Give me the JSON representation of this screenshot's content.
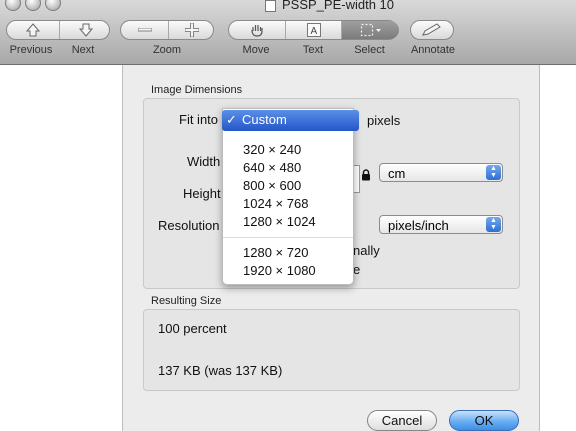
{
  "window": {
    "title": "PSSP_PE-width 10"
  },
  "toolbar": {
    "previous_label": "Previous",
    "next_label": "Next",
    "zoom_label": "Zoom",
    "move_label": "Move",
    "text_label": "Text",
    "select_label": "Select",
    "annotate_label": "Annotate"
  },
  "image_dimensions": {
    "group_title": "Image Dimensions",
    "fit_into_label": "Fit into",
    "fit_into_value": "Custom",
    "fit_into_check": "✓",
    "fit_into_unit": "pixels",
    "width_label": "Width",
    "height_label": "Height",
    "size_unit_value": "cm",
    "resolution_label": "Resolution",
    "resolution_unit_value": "pixels/inch",
    "scale_proportionally_partial": "nally",
    "resample_partial": "e"
  },
  "fit_into_menu": {
    "options": [
      "320 × 240",
      "640 × 480",
      "800 × 600",
      "1024 × 768",
      "1280 × 1024",
      "1280 × 720",
      "1920 × 1080"
    ]
  },
  "resulting_size": {
    "group_title": "Resulting Size",
    "percent": "100 percent",
    "size": "137 KB (was 137 KB)"
  },
  "buttons": {
    "cancel_label": "Cancel",
    "ok_label": "OK"
  }
}
